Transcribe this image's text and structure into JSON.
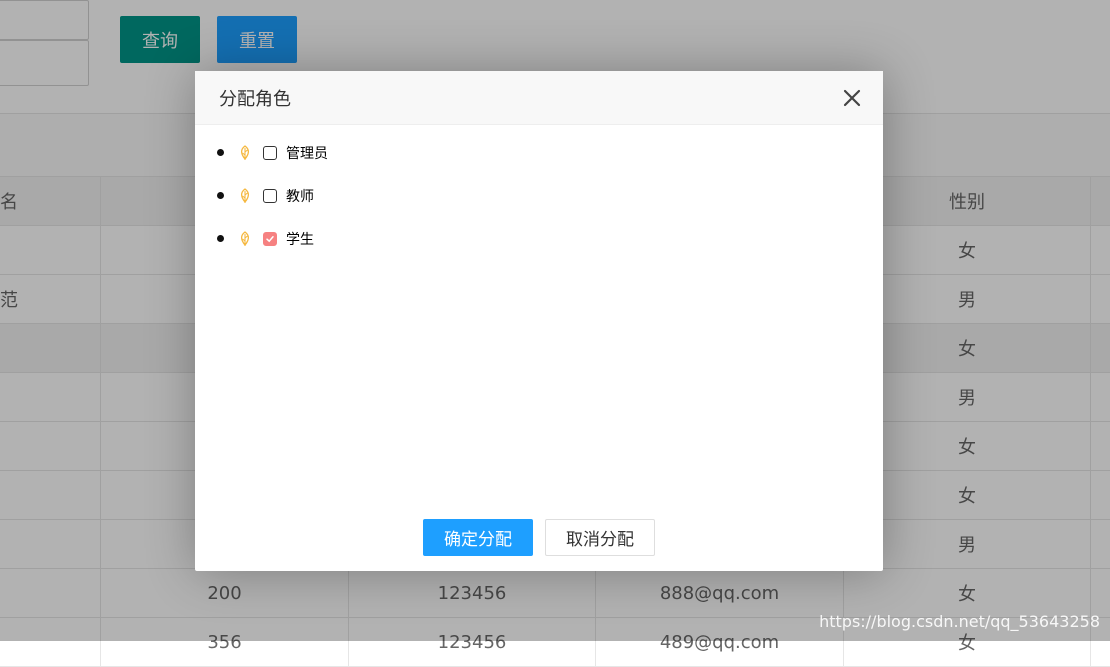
{
  "search_bar": {
    "query_label": "查询",
    "reset_label": "重置"
  },
  "table": {
    "header": [
      "名",
      "",
      "",
      "",
      "性别"
    ],
    "rows": [
      [
        "",
        "",
        "",
        "",
        "女"
      ],
      [
        "范",
        "",
        "",
        "",
        "男"
      ],
      [
        "",
        "",
        "",
        "",
        "女"
      ],
      [
        "",
        "",
        "",
        "",
        "男"
      ],
      [
        "",
        "",
        "",
        "",
        "女"
      ],
      [
        "",
        "",
        "",
        "",
        "女"
      ],
      [
        "",
        "",
        "",
        "",
        "男"
      ],
      [
        "",
        "200",
        "123456",
        "888@qq.com",
        "女"
      ],
      [
        "",
        "356",
        "123456",
        "489@qq.com",
        "女"
      ]
    ]
  },
  "dialog": {
    "title": "分配角色",
    "roles": [
      {
        "label": "管理员",
        "checked": false
      },
      {
        "label": "教师",
        "checked": false
      },
      {
        "label": "学生",
        "checked": true
      }
    ],
    "confirm_label": "确定分配",
    "cancel_label": "取消分配"
  },
  "watermark": "https://blog.csdn.net/qq_53643258",
  "colors": {
    "query_button": "#009688",
    "reset_button": "#1e9fff",
    "primary_button": "#1e9fff",
    "checkbox_checked": "#f56c6c",
    "leaf_icon": "#f5b840"
  },
  "icons": {
    "close": "close-icon",
    "role_node": "leaf-icon"
  }
}
